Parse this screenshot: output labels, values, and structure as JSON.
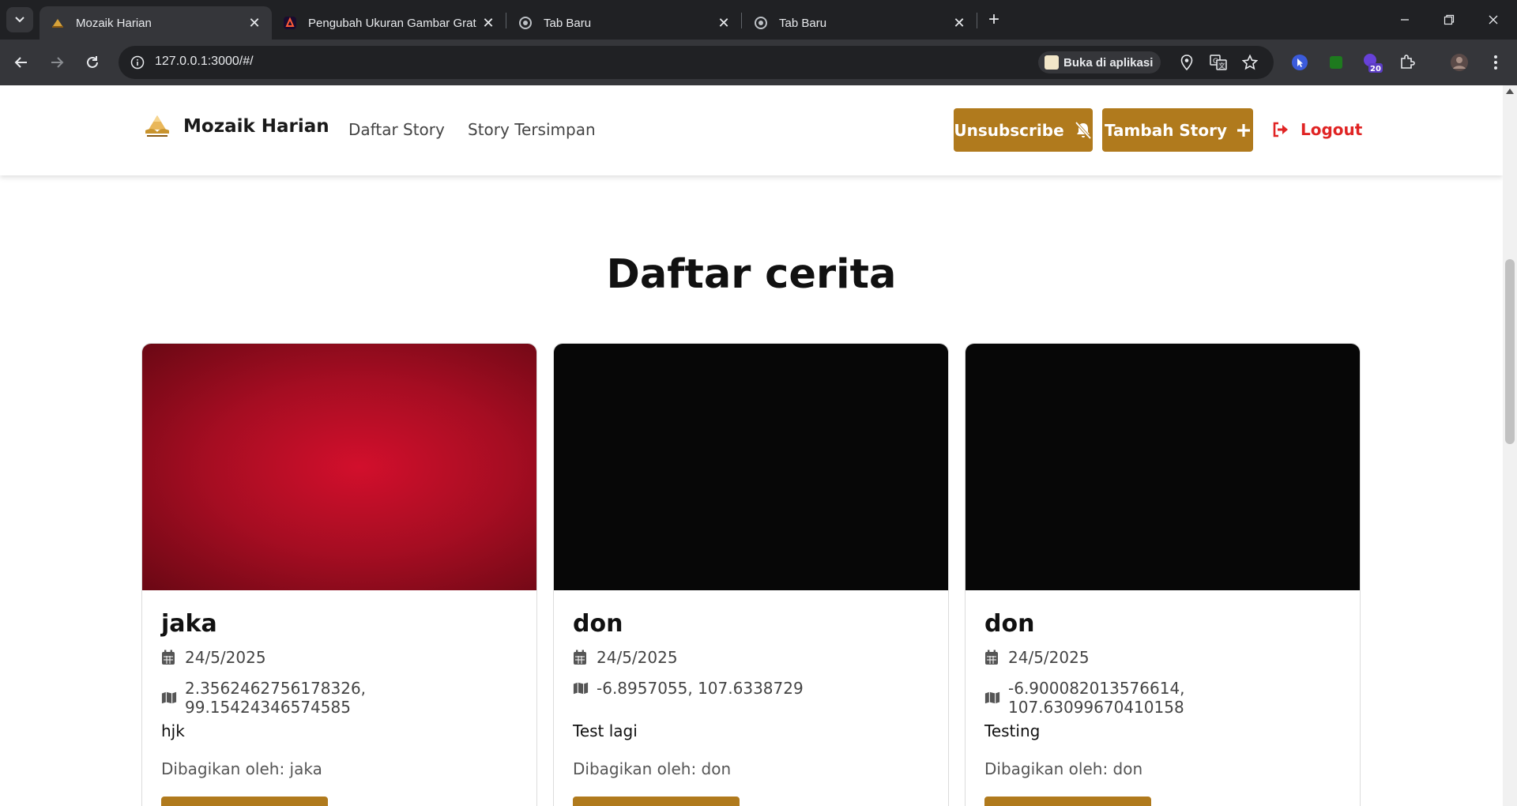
{
  "browser": {
    "tabs": [
      {
        "title": "Mozaik Harian",
        "active": true,
        "favicon": "mozaik-logo-icon"
      },
      {
        "title": "Pengubah Ukuran Gambar Grat",
        "active": false,
        "favicon": "adobe-express-icon"
      },
      {
        "title": "Tab Baru",
        "active": false,
        "favicon": "chrome-icon"
      },
      {
        "title": "Tab Baru",
        "active": false,
        "favicon": "chrome-icon"
      }
    ],
    "url": "127.0.0.1:3000/#/",
    "open_in_app_label": "Buka di aplikasi",
    "extension_badge": "20"
  },
  "header": {
    "brand_name": "Mozaik Harian",
    "nav": [
      "Daftar Story",
      "Story Tersimpan"
    ],
    "unsubscribe_label": "Unsubscribe",
    "add_story_label": "Tambah Story",
    "logout_label": "Logout"
  },
  "main": {
    "title": "Daftar cerita",
    "stories": [
      {
        "author": "jaka",
        "date": "24/5/2025",
        "location": "2.3562462756178326, 99.15424346574585",
        "description": "hjk",
        "shared_by": "Dibagikan oleh: jaka",
        "image": "red-gradient"
      },
      {
        "author": "don",
        "date": "24/5/2025",
        "location": "-6.8957055, 107.6338729",
        "description": "Test lagi",
        "shared_by": "Dibagikan oleh: don",
        "image": "black"
      },
      {
        "author": "don",
        "date": "24/5/2025",
        "location": "-6.900082013576614, 107.63099670410158",
        "description": "Testing",
        "shared_by": "Dibagikan oleh: don",
        "image": "black"
      }
    ]
  },
  "colors": {
    "accent": "#b07a1d",
    "logout": "#e02424",
    "browser_dark": "#202124",
    "browser_toolbar": "#35363a"
  }
}
